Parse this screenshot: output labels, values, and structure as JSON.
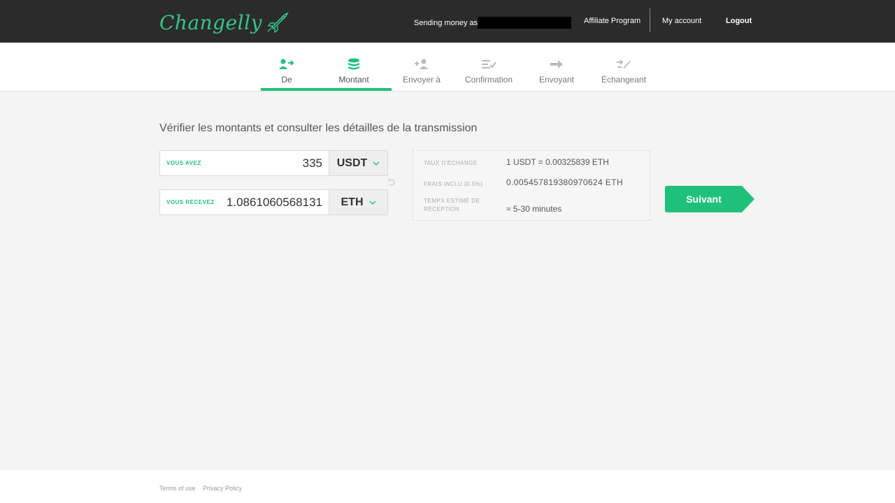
{
  "header": {
    "logo_text": "Changelly",
    "sending_label": "Sending money as",
    "affiliate": "Affiliate Program",
    "account": "My account",
    "logout": "Logout"
  },
  "steps": [
    {
      "label": "De",
      "icon": "user-arrow-icon",
      "active": true
    },
    {
      "label": "Montant",
      "icon": "coins-stack-icon",
      "active": true
    },
    {
      "label": "Envoyer à",
      "icon": "add-user-icon",
      "active": false
    },
    {
      "label": "Confirmation",
      "icon": "list-check-icon",
      "active": false
    },
    {
      "label": "Envoyant",
      "icon": "arrow-right-icon",
      "active": false
    },
    {
      "label": "Échangeant",
      "icon": "exchange-rocket-icon",
      "active": false
    }
  ],
  "main": {
    "title": "Vérifier les montants et consulter les détailles de la transmission",
    "send": {
      "label": "VOUS AVEZ",
      "amount": "335",
      "currency": "USDT"
    },
    "receive": {
      "label": "VOUS RECEVEZ",
      "amount": "1.0861060568131",
      "currency": "ETH"
    },
    "info": {
      "rate_label": "TAUX D'ÉCHANGE",
      "rate_value": "1 USDT = 0.00325839 ETH",
      "fee_label": "FRAIS INCLU (0.5%)",
      "fee_value": "0.005457819380970624 ETH",
      "time_label_1": "TEMPS ESTIMÉ DE",
      "time_label_2": "RÉCEPTION",
      "time_value": "≈ 5-30 minutes"
    },
    "next_button": "Suivant"
  },
  "footer": {
    "terms": "Terms of use",
    "privacy": "Privacy Policy"
  },
  "colors": {
    "accent": "#1fc17a",
    "header_bg": "#2b2b2b",
    "page_bg": "#f4f4f4"
  }
}
